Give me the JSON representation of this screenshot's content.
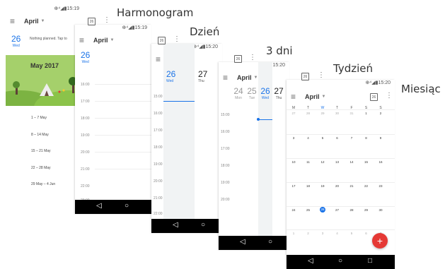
{
  "labels": [
    "Harmonogram",
    "Dzień",
    "3 dni",
    "Tydzień",
    "Miesiąc"
  ],
  "status_time": [
    "15:19",
    "15:19",
    "15:20",
    "15:20",
    "15:20"
  ],
  "month": "April",
  "schedule": {
    "day_num": "26",
    "day_name": "Wed",
    "note": "Nothing planned. Tap to",
    "banner": "May 2017",
    "weeks": [
      "1 – 7 May",
      "8 – 14 May",
      "15 – 21 May",
      "22 – 28 May",
      "29 May – 4 Jun"
    ]
  },
  "day": {
    "day_num": "26",
    "day_name": "Wed",
    "times": [
      "16:00",
      "17:00",
      "18:00",
      "19:00",
      "20:00",
      "21:00",
      "22:00",
      "23:00"
    ]
  },
  "three_day": {
    "days": [
      {
        "num": "26",
        "name": "Wed"
      },
      {
        "num": "27",
        "name": "Thu"
      }
    ],
    "times": [
      "15:00",
      "16:00",
      "17:00",
      "18:00",
      "19:00",
      "20:00",
      "21:00",
      "22:00"
    ]
  },
  "week": {
    "days": [
      {
        "num": "24",
        "name": "Mon"
      },
      {
        "num": "25",
        "name": "Tue"
      },
      {
        "num": "26",
        "name": "Wed"
      },
      {
        "num": "27",
        "name": "Thu"
      }
    ],
    "times": [
      "15:00",
      "16:00",
      "17:00",
      "18:00",
      "19:00",
      "20:00"
    ]
  },
  "month_view": {
    "headers": [
      "M",
      "T",
      "W",
      "T",
      "F",
      "S",
      "S"
    ],
    "rows": [
      [
        "27",
        "28",
        "29",
        "30",
        "31",
        "1",
        "2"
      ],
      [
        "3",
        "4",
        "5",
        "6",
        "7",
        "8",
        "9"
      ],
      [
        "10",
        "11",
        "12",
        "13",
        "14",
        "15",
        "16"
      ],
      [
        "17",
        "18",
        "19",
        "20",
        "21",
        "22",
        "23"
      ],
      [
        "24",
        "25",
        "26",
        "27",
        "28",
        "29",
        "30"
      ],
      [
        "1",
        "2",
        "3",
        "4",
        "5",
        "6",
        "7"
      ]
    ],
    "fab": "+"
  },
  "nav": {
    "back": "◁",
    "home": "○",
    "recent": "□"
  },
  "colors": {
    "accent": "#1a73e8",
    "fab": "#e53935",
    "banner": "#8bc34a"
  }
}
